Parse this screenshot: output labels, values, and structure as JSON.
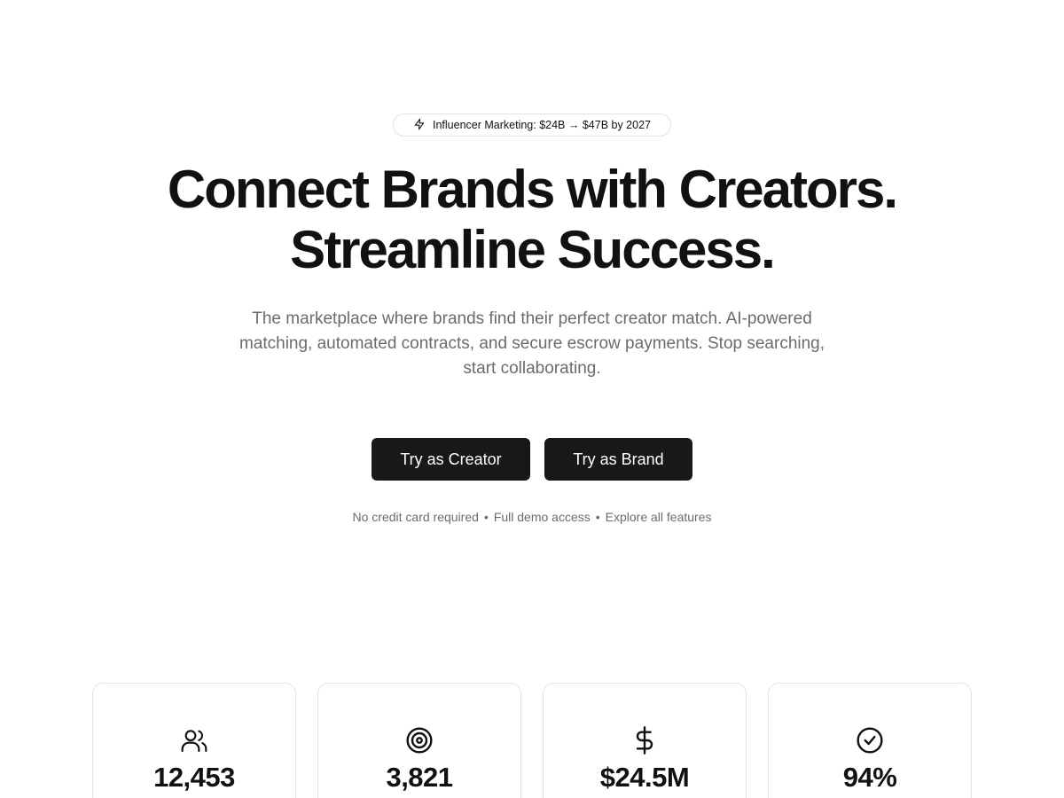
{
  "badge": {
    "icon": "zap-icon",
    "text": "Influencer Marketing: $24B → $47B by 2027"
  },
  "headline": {
    "line1": "Connect Brands with Creators.",
    "line2": "Streamline Success."
  },
  "subtitle": "The marketplace where brands find their perfect creator match. AI-powered matching, automated contracts, and secure escrow payments. Stop searching, start collaborating.",
  "cta": {
    "creator_label": "Try as Creator",
    "brand_label": "Try as Brand"
  },
  "fineprint": {
    "item1": "No credit card required",
    "item2": "Full demo access",
    "item3": "Explore all features",
    "separator": "•"
  },
  "stats": [
    {
      "icon": "users-icon",
      "value": "12,453"
    },
    {
      "icon": "target-icon",
      "value": "3,821"
    },
    {
      "icon": "dollar-icon",
      "value": "$24.5M"
    },
    {
      "icon": "check-circle-icon",
      "value": "94%"
    }
  ],
  "colors": {
    "button_bg": "#18181b",
    "text_primary": "#111111",
    "text_muted": "#6b6b6b",
    "border": "#e4e4e7"
  }
}
